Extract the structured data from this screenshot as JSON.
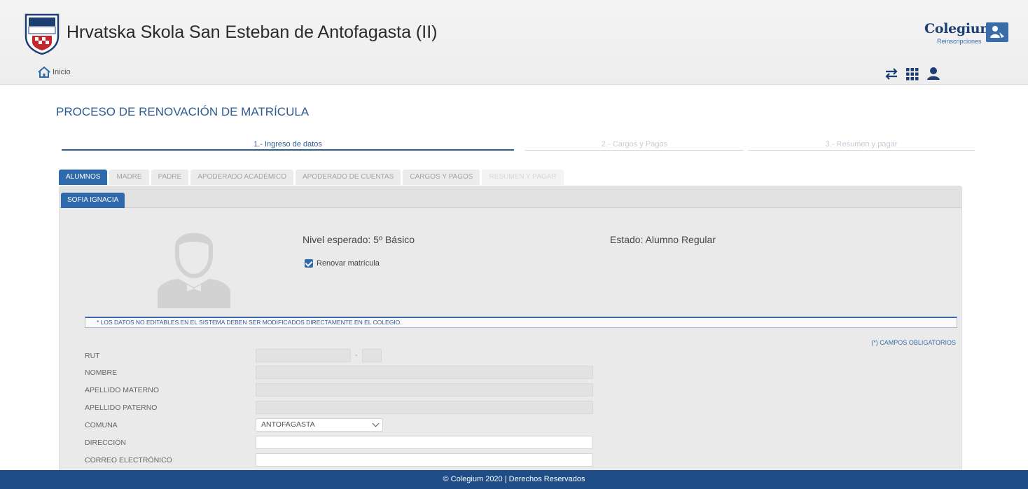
{
  "header": {
    "school_name": "Hrvatska Skola San Esteban de Antofagasta (II)",
    "brand_name": "Colegium",
    "brand_sub": "Reinscripciones",
    "home_label": "Inicio"
  },
  "process_title": "PROCESO DE RENOVACIÓN DE MATRÍCULA",
  "steps": [
    {
      "label": "1.- Ingreso de datos",
      "state": "active"
    },
    {
      "label": "2.- Cargos y Pagos",
      "state": "inactive"
    },
    {
      "label": "3.- Resumen y pagar",
      "state": "inactive"
    }
  ],
  "tabs": [
    {
      "label": "ALUMNOS",
      "state": "active"
    },
    {
      "label": "MADRE",
      "state": "normal"
    },
    {
      "label": "PADRE",
      "state": "normal"
    },
    {
      "label": "APODERADO ACADÉMICO",
      "state": "normal"
    },
    {
      "label": "APODERADO DE CUENTAS",
      "state": "normal"
    },
    {
      "label": "CARGOS Y PAGOS",
      "state": "normal"
    },
    {
      "label": "RESUMEN Y PAGAR",
      "state": "disabled"
    }
  ],
  "student_tab": "SOFIA IGNACIA",
  "student": {
    "nivel": "Nivel esperado: 5º Básico",
    "estado": "Estado: Alumno Regular",
    "renovar_label": "Renovar matrícula",
    "renovar_checked": true
  },
  "notice": "* LOS DATOS NO EDITABLES EN EL SISTEMA DEBEN SER MODIFICADOS DIRECTAMENTE EN EL COLEGIO.",
  "required_note": "(*) CAMPOS OBLIGATORIOS",
  "form": {
    "rut_label": "RUT",
    "rut_sep": "-",
    "nombre_label": "NOMBRE",
    "apellido_materno_label": "APELLIDO MATERNO",
    "apellido_paterno_label": "APELLIDO PATERNO",
    "comuna_label": "COMUNA",
    "comuna_value": "ANTOFAGASTA",
    "direccion_label": "DIRECCIÓN",
    "correo_label": "CORREO ELECTRÓNICO"
  },
  "footer": "© Colegium 2020 | Derechos Reservados",
  "colors": {
    "primary": "#2e69ab",
    "footer": "#1f4d87",
    "title": "#2e5d94"
  }
}
